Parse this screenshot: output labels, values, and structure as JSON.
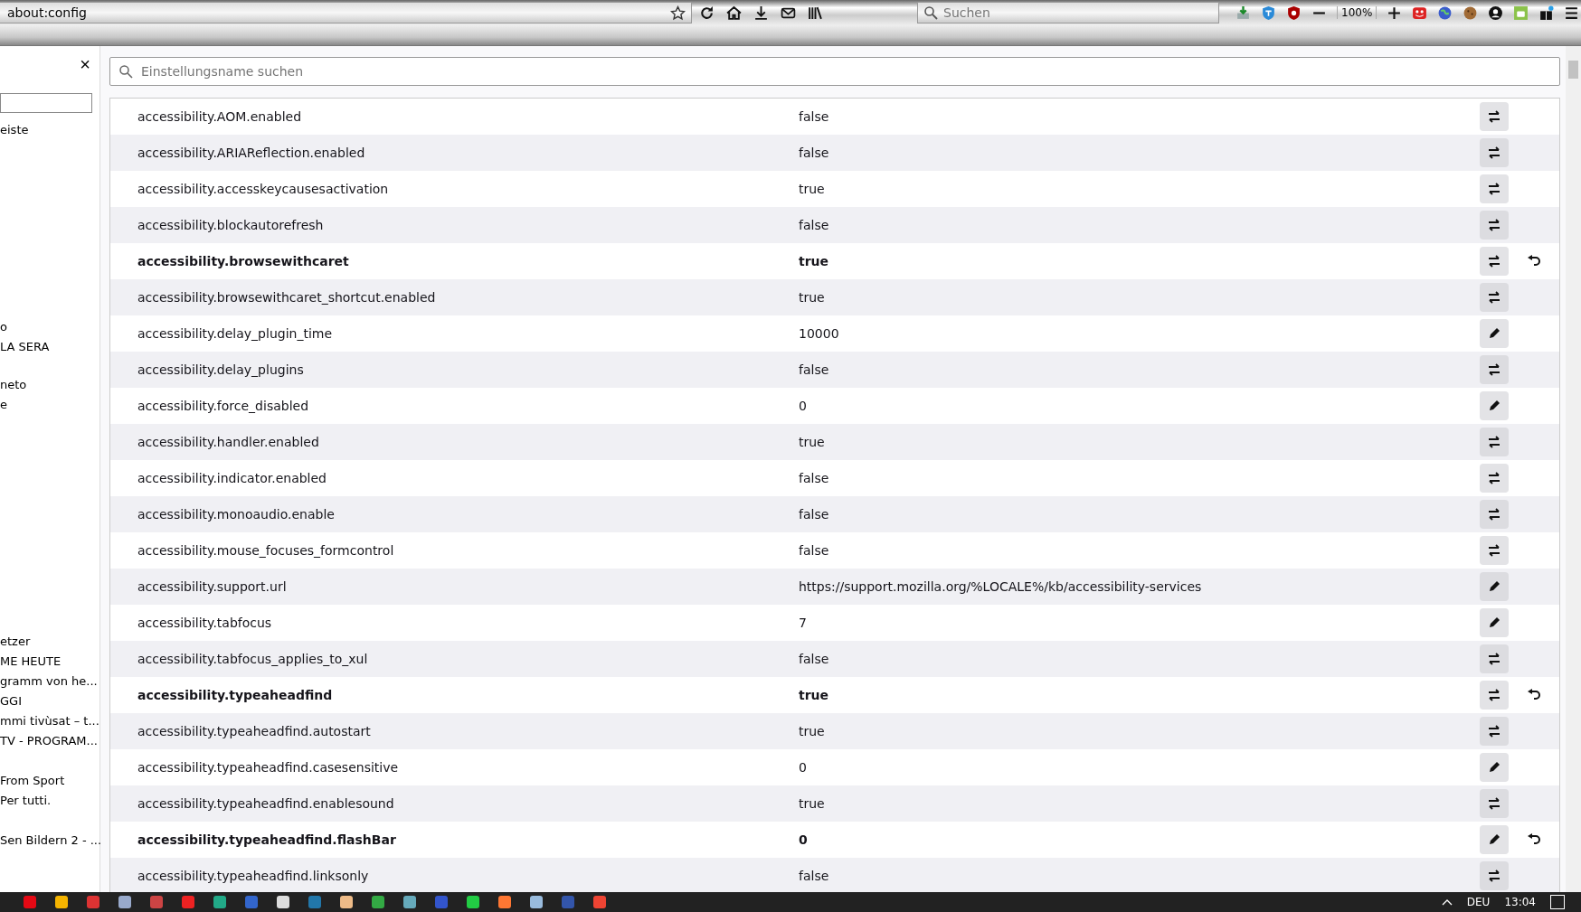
{
  "toolbar": {
    "url": "about:config",
    "search": {
      "placeholder": "Suchen"
    },
    "zoom": "100%"
  },
  "sidebar": {
    "close": "×",
    "groups": [
      [
        "eiste"
      ],
      [
        "o",
        "LA SERA"
      ],
      [
        "neto",
        "e"
      ],
      [
        "etzer",
        "ME HEUTE",
        "gramm von he...",
        "GGI",
        "mmi tivùsat – t...",
        "TV - PROGRAM..."
      ],
      [
        "From Sport",
        "Per tutti."
      ],
      [
        "Sen Bildern 2 - ..."
      ]
    ]
  },
  "search": {
    "placeholder": "Einstellungsname suchen"
  },
  "prefs": [
    {
      "name": "accessibility.AOM.enabled",
      "value": "false",
      "kind": "toggle",
      "modified": false
    },
    {
      "name": "accessibility.ARIAReflection.enabled",
      "value": "false",
      "kind": "toggle",
      "modified": false
    },
    {
      "name": "accessibility.accesskeycausesactivation",
      "value": "true",
      "kind": "toggle",
      "modified": false
    },
    {
      "name": "accessibility.blockautorefresh",
      "value": "false",
      "kind": "toggle",
      "modified": false
    },
    {
      "name": "accessibility.browsewithcaret",
      "value": "true",
      "kind": "toggle",
      "modified": true
    },
    {
      "name": "accessibility.browsewithcaret_shortcut.enabled",
      "value": "true",
      "kind": "toggle",
      "modified": false
    },
    {
      "name": "accessibility.delay_plugin_time",
      "value": "10000",
      "kind": "edit",
      "modified": false
    },
    {
      "name": "accessibility.delay_plugins",
      "value": "false",
      "kind": "toggle",
      "modified": false
    },
    {
      "name": "accessibility.force_disabled",
      "value": "0",
      "kind": "edit",
      "modified": false
    },
    {
      "name": "accessibility.handler.enabled",
      "value": "true",
      "kind": "toggle",
      "modified": false
    },
    {
      "name": "accessibility.indicator.enabled",
      "value": "false",
      "kind": "toggle",
      "modified": false
    },
    {
      "name": "accessibility.monoaudio.enable",
      "value": "false",
      "kind": "toggle",
      "modified": false
    },
    {
      "name": "accessibility.mouse_focuses_formcontrol",
      "value": "false",
      "kind": "toggle",
      "modified": false
    },
    {
      "name": "accessibility.support.url",
      "value": "https://support.mozilla.org/%LOCALE%/kb/accessibility-services",
      "kind": "edit",
      "modified": false
    },
    {
      "name": "accessibility.tabfocus",
      "value": "7",
      "kind": "edit",
      "modified": false
    },
    {
      "name": "accessibility.tabfocus_applies_to_xul",
      "value": "false",
      "kind": "toggle",
      "modified": false
    },
    {
      "name": "accessibility.typeaheadfind",
      "value": "true",
      "kind": "toggle",
      "modified": true
    },
    {
      "name": "accessibility.typeaheadfind.autostart",
      "value": "true",
      "kind": "toggle",
      "modified": false
    },
    {
      "name": "accessibility.typeaheadfind.casesensitive",
      "value": "0",
      "kind": "edit",
      "modified": false
    },
    {
      "name": "accessibility.typeaheadfind.enablesound",
      "value": "true",
      "kind": "toggle",
      "modified": false
    },
    {
      "name": "accessibility.typeaheadfind.flashBar",
      "value": "0",
      "kind": "edit",
      "modified": true
    },
    {
      "name": "accessibility.typeaheadfind.linksonly",
      "value": "false",
      "kind": "toggle",
      "modified": false
    }
  ],
  "taskbar": {
    "language": "DEU",
    "time": "13:04"
  }
}
